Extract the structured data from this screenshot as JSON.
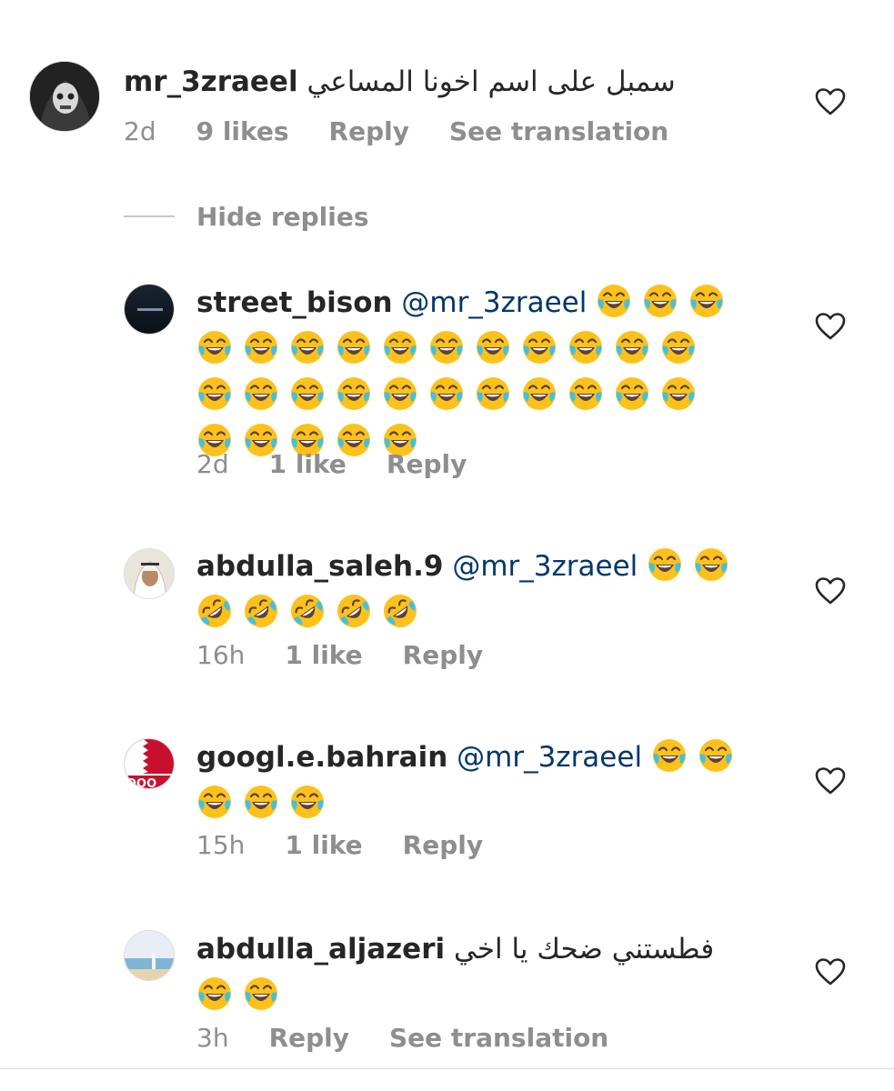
{
  "comments": {
    "c0": {
      "username": "mr_3zraeel",
      "text": "سمبل على اسم اخونا المساعي",
      "time": "2d",
      "likes": "9 likes",
      "reply": "Reply",
      "translate": "See translation"
    },
    "hide_replies": "Hide replies",
    "c1": {
      "username": "street_bison",
      "mention": "@mr_3zraeel",
      "emojis": [
        "joy",
        "joy",
        "joy",
        "joy",
        "joy",
        "joy",
        "joy",
        "joy",
        "joy",
        "joy",
        "joy",
        "joy",
        "joy",
        "joy",
        "joy",
        "joy",
        "joy",
        "joy",
        "joy",
        "joy",
        "joy",
        "joy",
        "joy",
        "joy",
        "joy",
        "joy",
        "joy",
        "joy",
        "joy",
        "joy"
      ],
      "time": "2d",
      "likes": "1 like",
      "reply": "Reply"
    },
    "c2": {
      "username": "abdulla_saleh.9",
      "mention": "@mr_3zraeel",
      "emojis": [
        "joy",
        "joy",
        "rofl",
        "rofl",
        "rofl",
        "rofl",
        "rofl"
      ],
      "time": "16h",
      "likes": "1 like",
      "reply": "Reply"
    },
    "c3": {
      "username": "googl.e.bahrain",
      "mention": "@mr_3zraeel",
      "emojis": [
        "joy",
        "joy",
        "joy",
        "joy",
        "joy"
      ],
      "time": "15h",
      "likes": "1 like",
      "reply": "Reply"
    },
    "c4": {
      "username": "abdulla_aljazeri",
      "text": "فطستني ضحك يا اخي",
      "emojis": [
        "joy",
        "joy"
      ],
      "time": "3h",
      "reply": "Reply",
      "translate": "See translation"
    }
  },
  "icons": {
    "like": "heart-outline-icon"
  },
  "colors": {
    "text": "#262626",
    "meta": "#8e8e8e",
    "mention": "#00376b"
  }
}
